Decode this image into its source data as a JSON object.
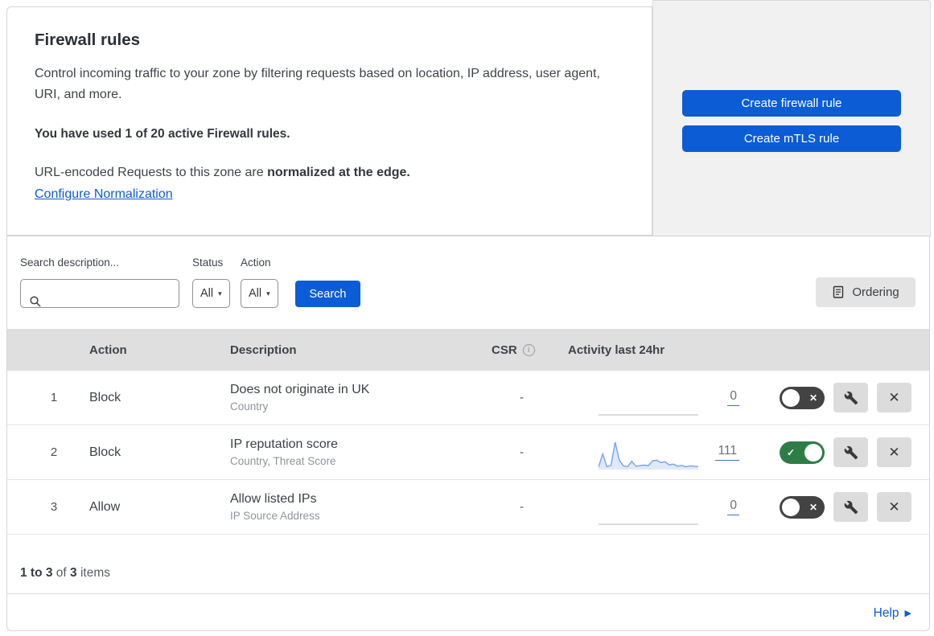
{
  "header": {
    "title": "Firewall rules",
    "description": "Control incoming traffic to your zone by filtering requests based on location, IP address, user agent, URI, and more.",
    "usage_notice": "You have used 1 of 20 active Firewall rules.",
    "normalization_text": "URL-encoded Requests to this zone are ",
    "normalization_bold": "normalized at the edge.",
    "normalization_link": "Configure Normalization"
  },
  "actions_panel": {
    "create_firewall_rule": "Create firewall rule",
    "create_mtls_rule": "Create mTLS rule"
  },
  "filters": {
    "search_label": "Search description...",
    "status": {
      "label": "Status",
      "value": "All"
    },
    "action": {
      "label": "Action",
      "value": "All"
    },
    "search_button": "Search",
    "ordering_button": "Ordering"
  },
  "table": {
    "headers": {
      "action": "Action",
      "description": "Description",
      "csr": "CSR",
      "activity": "Activity last 24hr"
    },
    "rows": [
      {
        "priority": "1",
        "action": "Block",
        "description": "Does not originate in UK",
        "criteria": "Country",
        "csr": "-",
        "activity_count": "0",
        "enabled": false,
        "sparkline": [
          0,
          0,
          0,
          0,
          0,
          0,
          0,
          0,
          0,
          0,
          0,
          0
        ]
      },
      {
        "priority": "2",
        "action": "Block",
        "description": "IP reputation score",
        "criteria": "Country, Threat Score",
        "csr": "-",
        "activity_count": "111",
        "enabled": true,
        "sparkline": [
          3,
          55,
          5,
          10,
          100,
          30,
          8,
          5,
          26,
          7,
          9,
          11,
          9,
          28,
          30,
          21,
          24,
          12,
          15,
          7,
          10,
          5,
          8,
          7,
          5
        ]
      },
      {
        "priority": "3",
        "action": "Allow",
        "description": "Allow listed IPs",
        "criteria": "IP Source Address",
        "csr": "-",
        "activity_count": "0",
        "enabled": false,
        "sparkline": [
          0,
          0,
          0,
          0,
          0,
          0,
          0,
          0,
          0,
          0,
          0,
          0
        ]
      }
    ]
  },
  "footer": {
    "range": "1 to 3",
    "of": " of ",
    "total": "3",
    "items": " items",
    "help": "Help"
  },
  "colors": {
    "primary_blue": "#0b5cd5",
    "toggle_on_green": "#2e7d46",
    "toggle_off_gray": "#434343",
    "sparkline_line": "#76a3e8",
    "sparkline_fill": "#dfe9f9"
  }
}
